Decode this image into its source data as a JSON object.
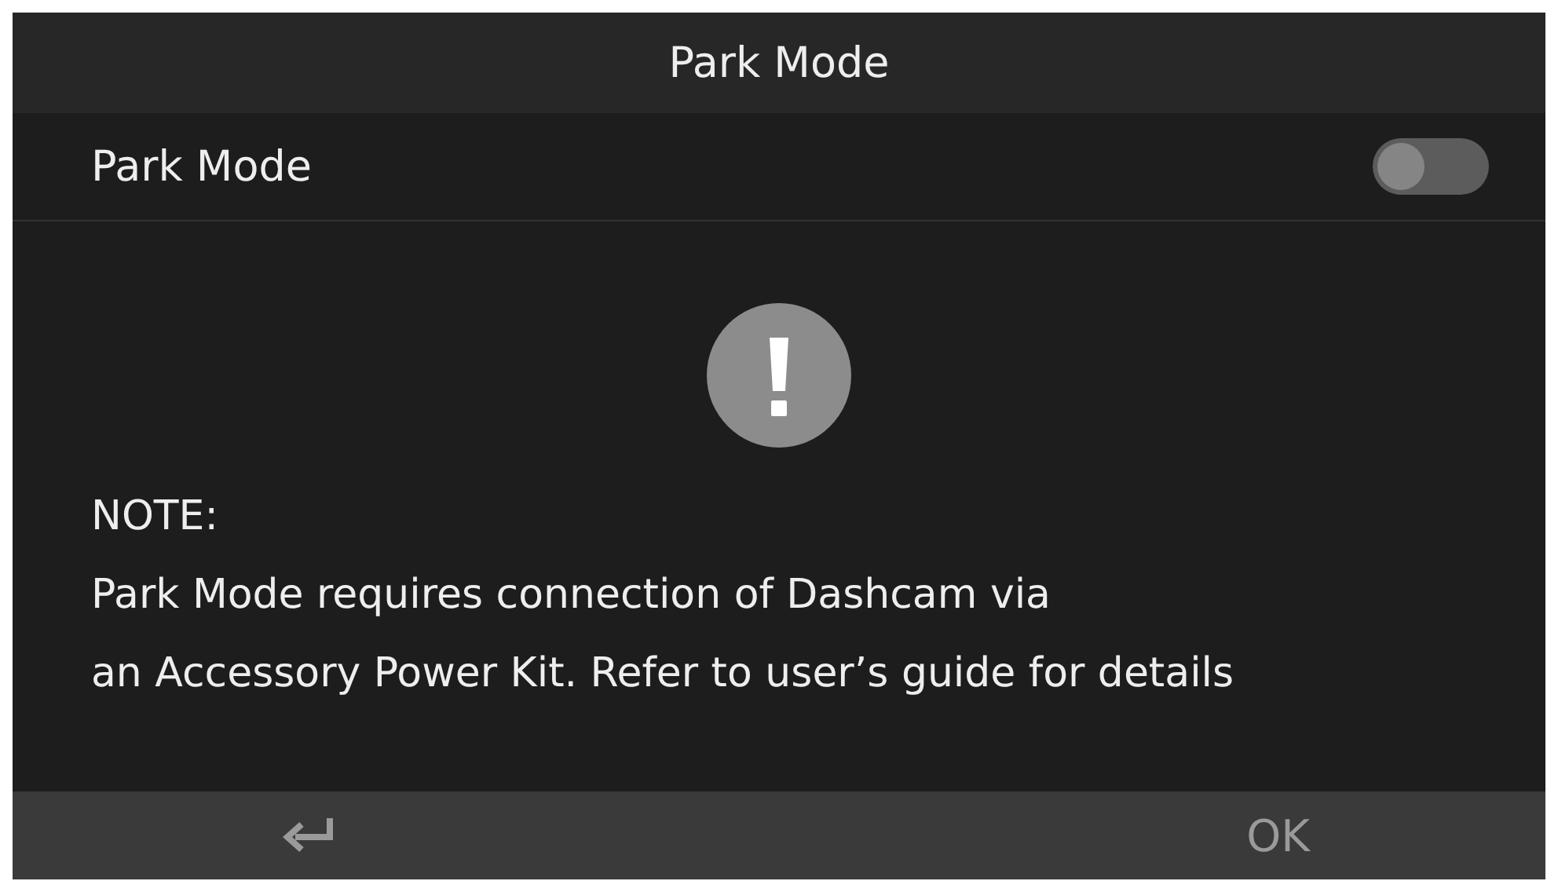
{
  "title_bar": {
    "title": "Park Mode"
  },
  "setting": {
    "label": "Park Mode",
    "on": false
  },
  "note": {
    "heading": "NOTE:",
    "lines": [
      "Park Mode requires connection of Dashcam via",
      "an Accessory Power Kit. Refer to user’s guide for details"
    ]
  },
  "footer": {
    "confirm": "OK"
  }
}
